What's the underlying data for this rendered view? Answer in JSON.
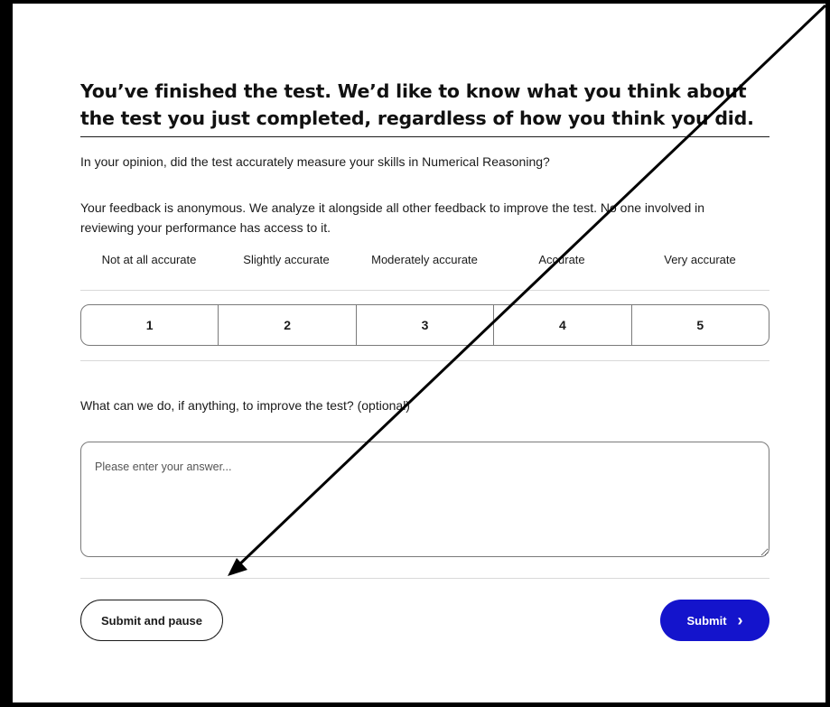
{
  "survey": {
    "heading": "You’ve finished the test. We’d like to know what you think about the test you just completed, regardless of how you think you did.",
    "question": "In your opinion, did the test accurately measure your skills in Numerical Reasoning?",
    "notice": "Your feedback is anonymous. We analyze it alongside all other feedback to improve the test. No one involved in reviewing your performance has access to it.",
    "scale_labels": [
      "Not at all accurate",
      "Slightly accurate",
      "Moderately accurate",
      "Accurate",
      "Very accurate"
    ],
    "ratings": [
      "1",
      "2",
      "3",
      "4",
      "5"
    ],
    "improve_label": "What can we do, if anything, to improve the test? (optional)",
    "answer_value": "",
    "answer_placeholder": "Please enter your answer..."
  },
  "actions": {
    "pause_label": "Submit and pause",
    "submit_label": "Submit",
    "submit_chevron": "›"
  },
  "colors": {
    "accent": "#1414cc",
    "frame": "#000000",
    "annotation_arrow": "#000000"
  },
  "icons": {
    "submit_icon": "chevron-right-icon",
    "annotation": "arrow-icon"
  }
}
